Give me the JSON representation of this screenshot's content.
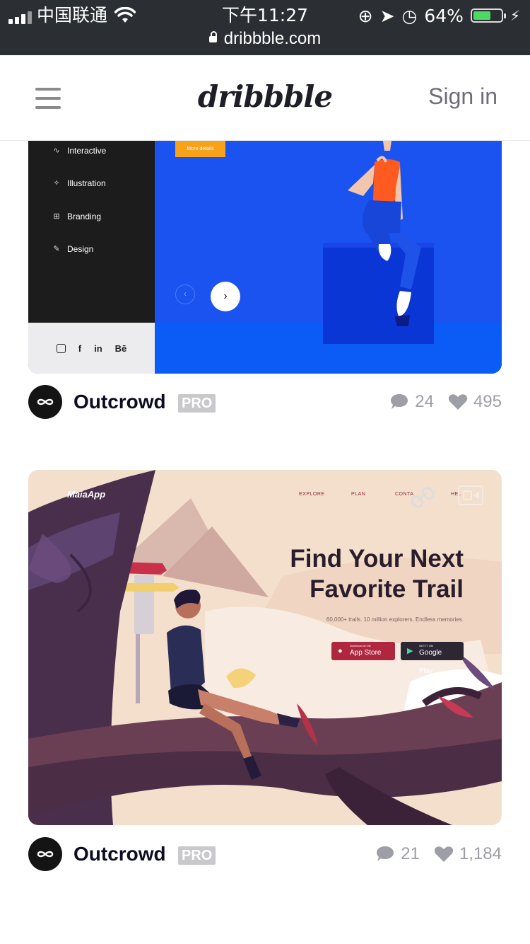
{
  "status_bar": {
    "carrier": "中国联通",
    "time": "下午11:27",
    "battery": "64%",
    "battery_level": 0.64,
    "url": "dribbble.com"
  },
  "header": {
    "logo": "dribbble",
    "signin": "Sign in"
  },
  "shot1": {
    "menu": [
      {
        "label": "Interactive",
        "icon": "pulse-icon"
      },
      {
        "label": "Illustration",
        "icon": "wand-icon"
      },
      {
        "label": "Branding",
        "icon": "grid-icon"
      },
      {
        "label": "Design",
        "icon": "pencil-icon"
      }
    ],
    "more_label": "More details",
    "social": [
      "instagram-icon",
      "f",
      "in",
      "Bē"
    ],
    "colors": {
      "side": "#1c1c1c",
      "accent": "#f8a21b",
      "bg": "#1a53f0"
    },
    "author": "Outcrowd",
    "badge": "PRO",
    "comments": "24",
    "likes": "495"
  },
  "shot2": {
    "app_name": "MaiaApp",
    "nav": [
      "EXPLORE",
      "PLAN",
      "CONTA",
      "HEL"
    ],
    "title_line1": "Find Your Next",
    "title_line2": "Favorite Trail",
    "subtitle": "60,000+ trails. 10 million explorers. Endless memories.",
    "appstore_small": "Download on the",
    "appstore": "App Store",
    "googleplay_small": "GET IT ON",
    "googleplay": "Google Play",
    "author": "Outcrowd",
    "badge": "PRO",
    "comments": "21",
    "likes": "1,184"
  }
}
